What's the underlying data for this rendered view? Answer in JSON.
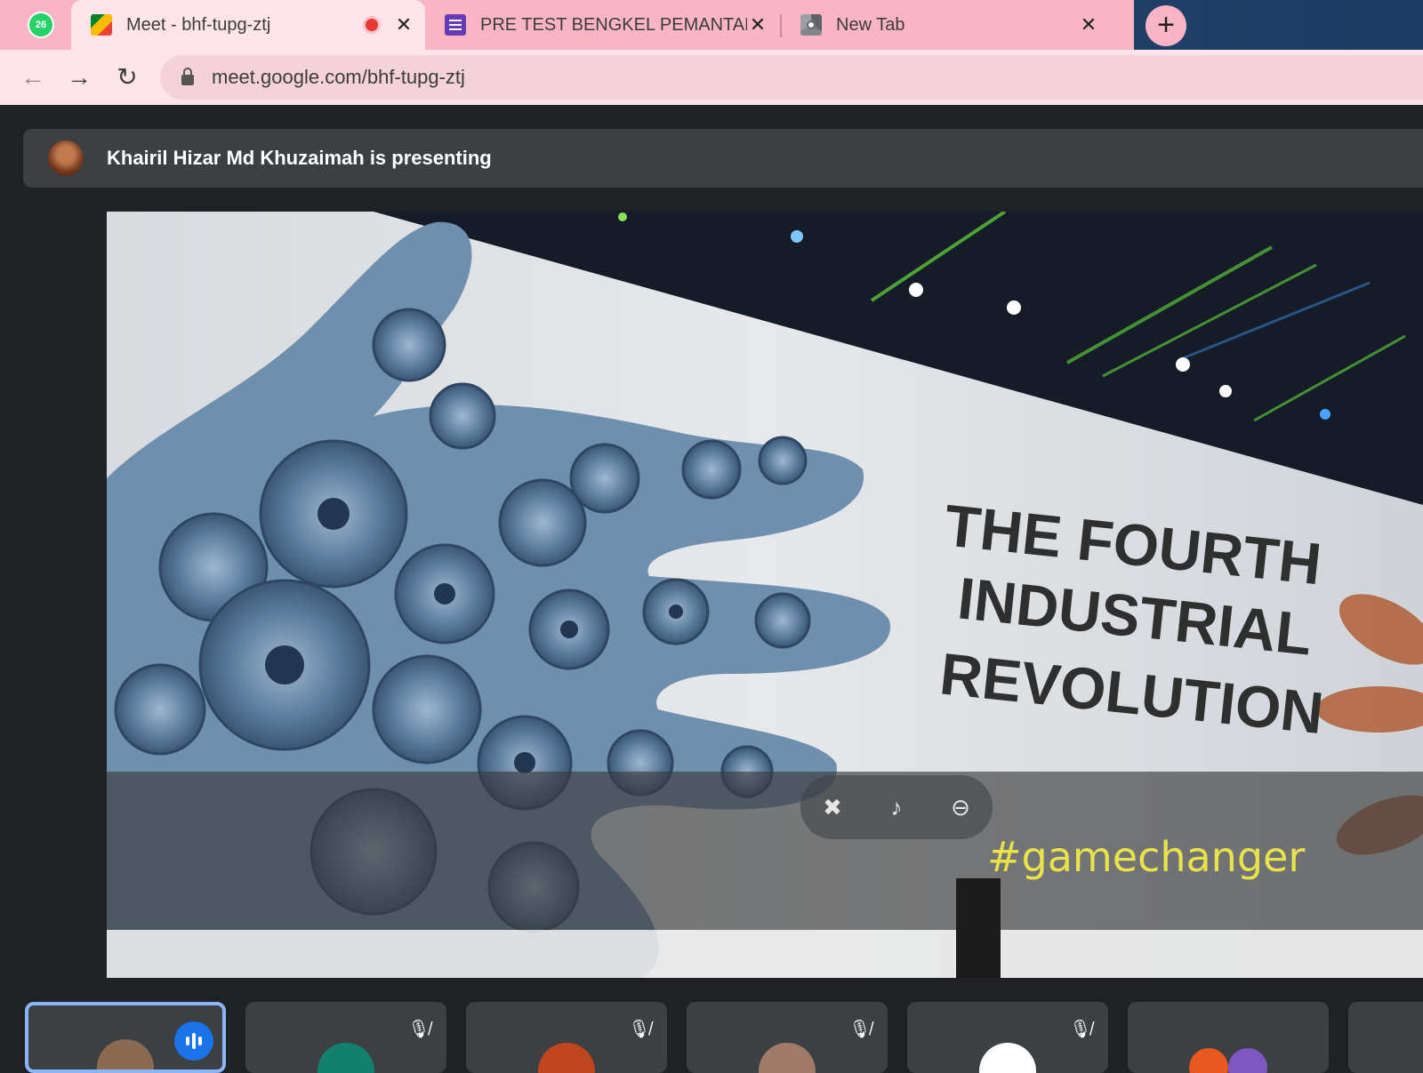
{
  "browser": {
    "pinned_badge": "26",
    "tabs": [
      {
        "title": "Meet - bhf-tupg-ztj",
        "recording": true
      },
      {
        "title": "PRE TEST BENGKEL PEMANTAPAN"
      },
      {
        "title": "New Tab"
      }
    ],
    "new_tab_label": "+",
    "url": "meet.google.com/bhf-tupg-ztj"
  },
  "meet": {
    "presenting_text": "Khairil Hizar Md Khuzaimah is presenting",
    "slide": {
      "headline_lines": [
        "THE FOURTH",
        "INDUSTRIAL",
        "REVOLUTION"
      ],
      "hashtag": "#gamechanger"
    }
  },
  "colors": {
    "tab_bar_pink": "#f9b5c5",
    "active_tab": "#ffe4ea",
    "meet_background": "#202124",
    "tile_background": "#3c4043",
    "speaking_blue": "#1a73e8",
    "hashtag_yellow": "#e9e24a"
  },
  "icons": {
    "back": "arrow-left-icon",
    "forward": "arrow-right-icon",
    "reload": "reload-icon",
    "lock": "lock-icon",
    "pin": "pin-off-icon",
    "mute": "mute-icon",
    "remove": "remove-icon"
  }
}
